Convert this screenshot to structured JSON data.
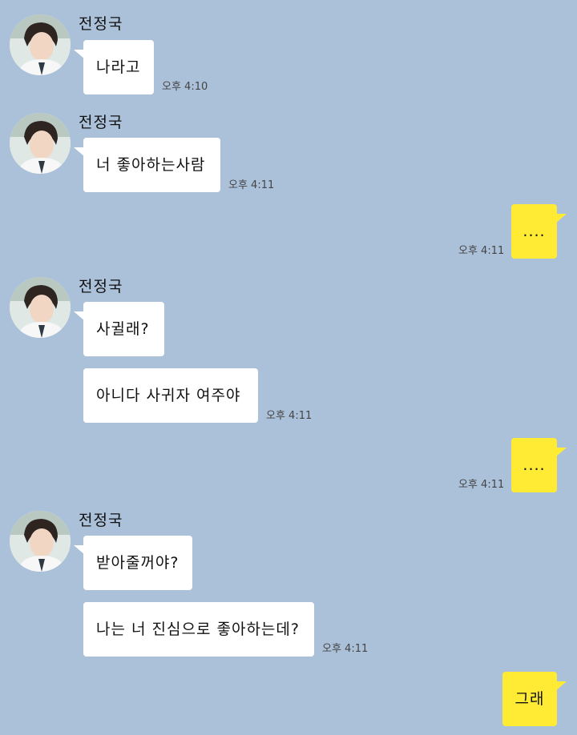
{
  "chat": {
    "groups": [
      {
        "sender": "전정국",
        "messages": [
          {
            "text": "나라고",
            "time": "오후 4:10"
          }
        ]
      },
      {
        "sender": "전정국",
        "messages": [
          {
            "text": "너 좋아하는사람",
            "time": "오후 4:11"
          }
        ]
      },
      {
        "mine": true,
        "messages": [
          {
            "text": "....",
            "time": "오후 4:11"
          }
        ]
      },
      {
        "sender": "전정국",
        "messages": [
          {
            "text": "사귈래?",
            "time": ""
          },
          {
            "text": "아니다 사귀자 여주야",
            "time": "오후 4:11"
          }
        ]
      },
      {
        "mine": true,
        "messages": [
          {
            "text": "....",
            "time": "오후 4:11"
          }
        ]
      },
      {
        "sender": "전정국",
        "messages": [
          {
            "text": "받아줄꺼야?",
            "time": ""
          },
          {
            "text": "나는 너 진심으로 좋아하는데?",
            "time": "오후 4:11"
          }
        ]
      },
      {
        "mine": true,
        "messages": [
          {
            "text": "그래",
            "time": ""
          }
        ]
      }
    ]
  }
}
